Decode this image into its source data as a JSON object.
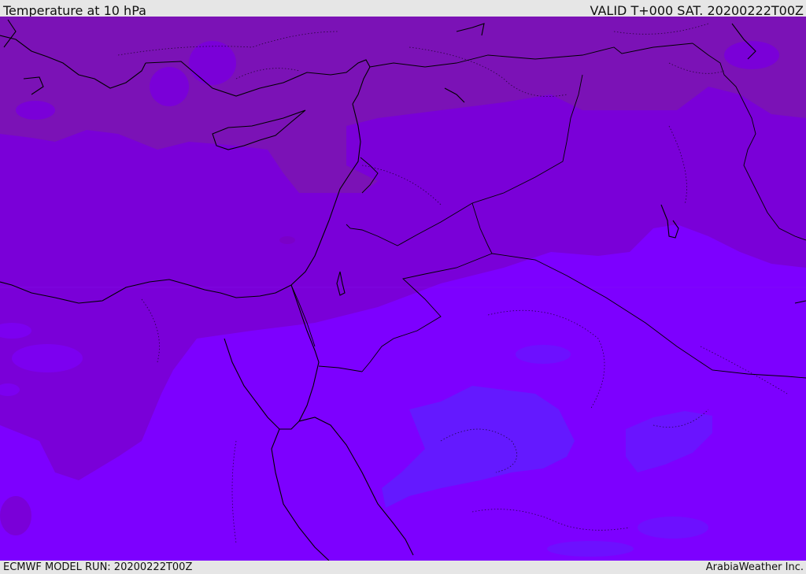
{
  "header": {
    "title": "Temperature at 10 hPa",
    "valid_time": "VALID T+000 SAT. 20200222T00Z"
  },
  "footer": {
    "model_run": "ECMWF MODEL RUN: 20200222T00Z",
    "credit": "ArabiaWeather Inc."
  },
  "map": {
    "fill_colors": {
      "warm_dark": "#7b12b6",
      "mid_dark": "#7a00d8",
      "mid": "#7c00f0",
      "cool": "#7d00ff",
      "coolest": "#6419ff"
    },
    "coastline_color": "#000000"
  }
}
